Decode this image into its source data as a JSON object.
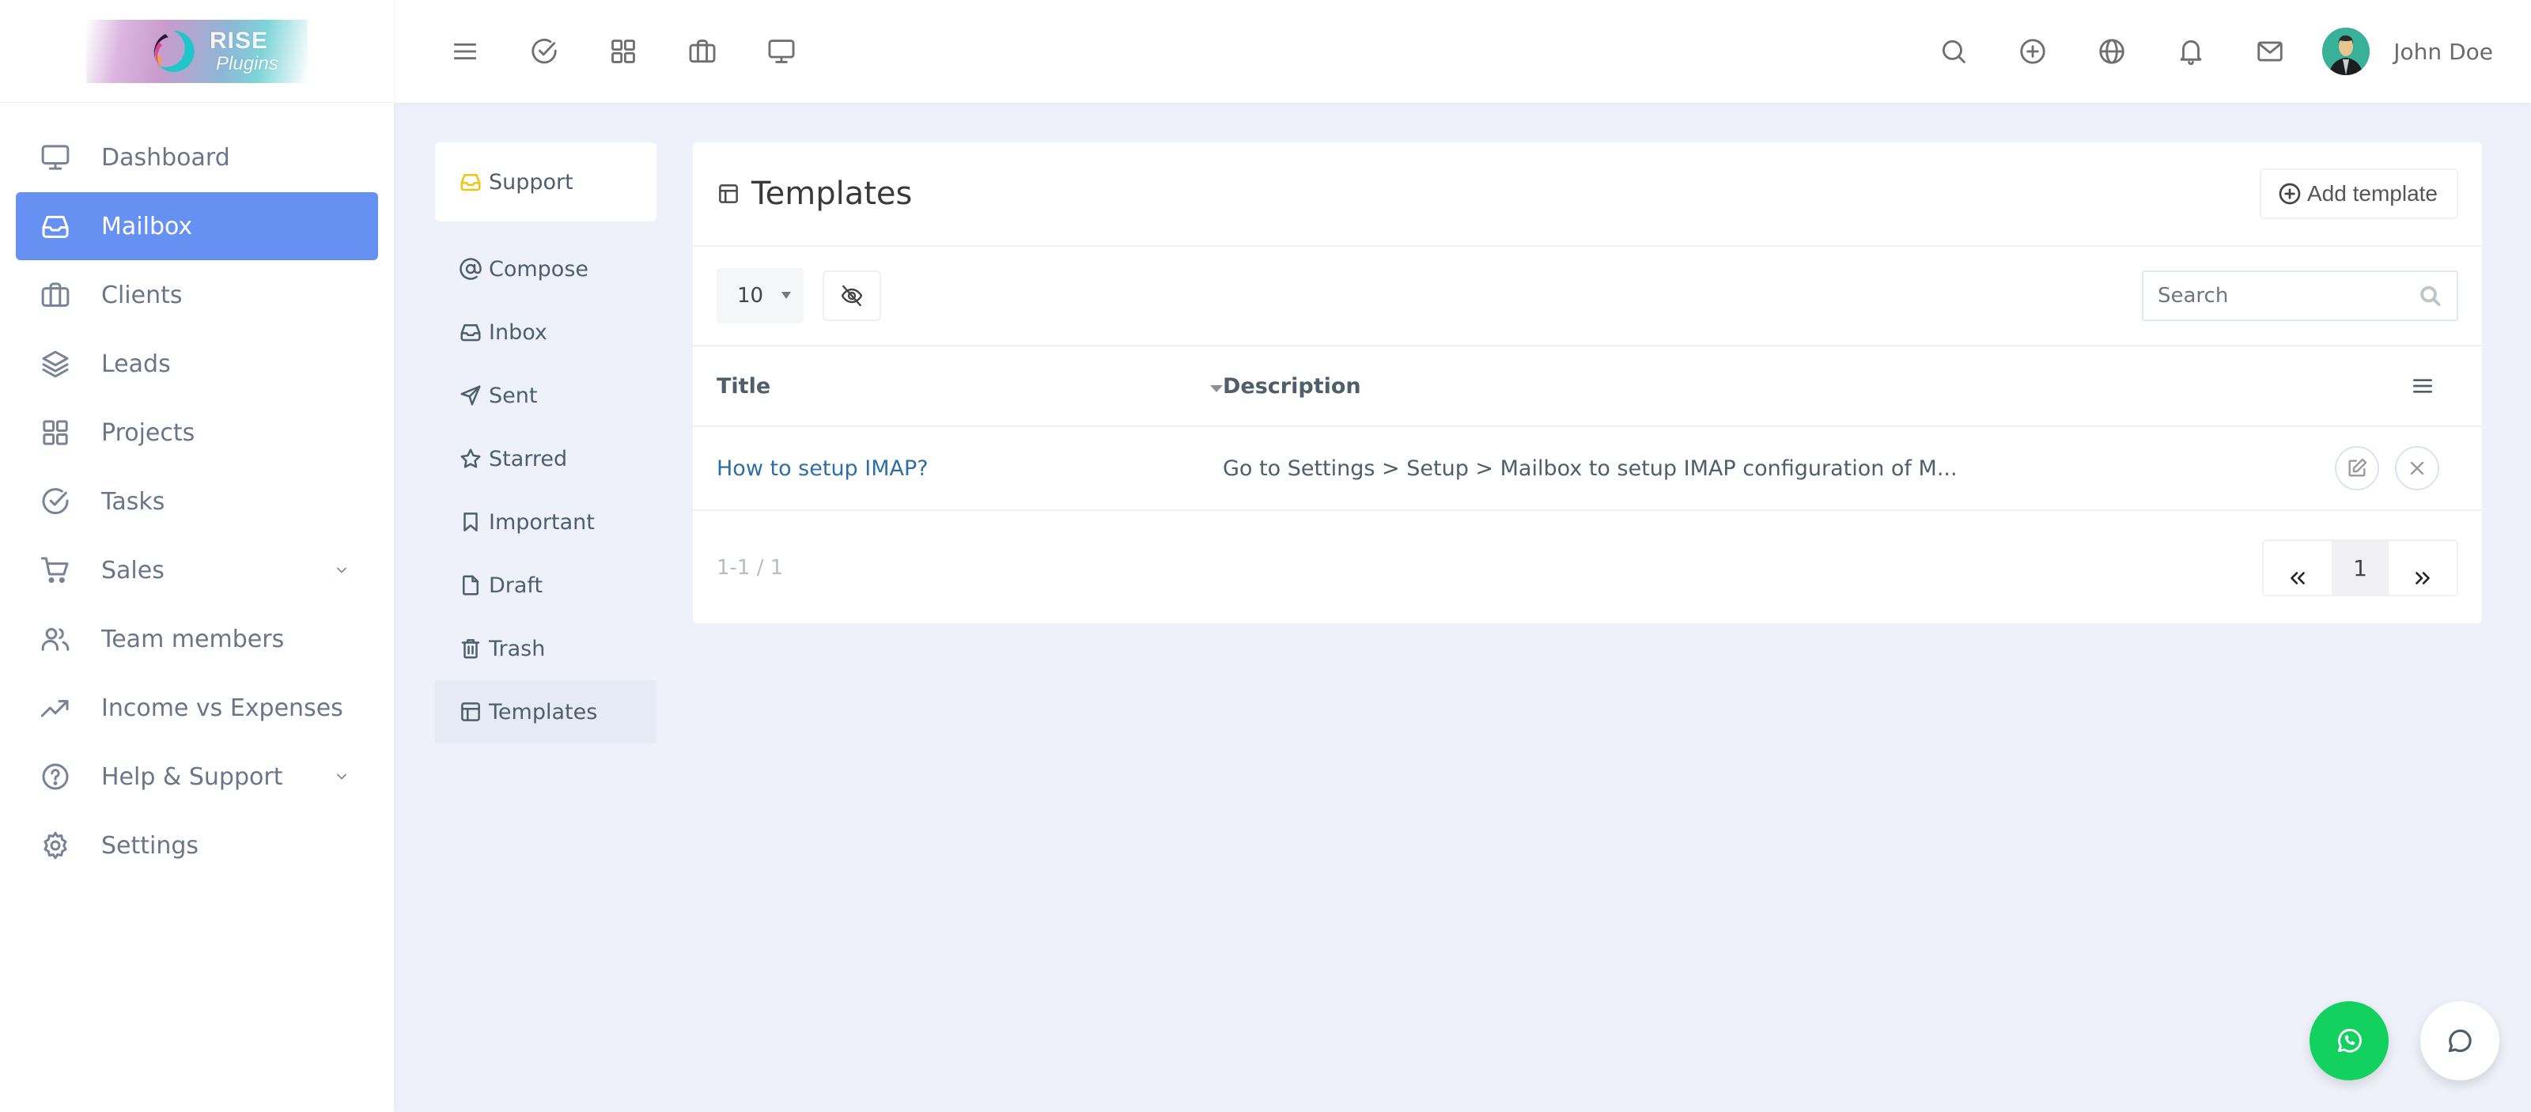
{
  "brand": {
    "line1": "RISE",
    "line2": "Plugins"
  },
  "topbar": {
    "left_icons": [
      "menu-icon",
      "check-circle-icon",
      "grid-icon",
      "briefcase-icon",
      "monitor-icon"
    ],
    "right_icons": [
      "search-icon",
      "plus-circle-icon",
      "globe-icon",
      "bell-icon",
      "mail-icon"
    ],
    "user_name": "John Doe"
  },
  "sidebar": {
    "items": [
      {
        "label": "Dashboard",
        "icon": "monitor-icon",
        "active": false,
        "has_submenu": false
      },
      {
        "label": "Mailbox",
        "icon": "inbox-icon",
        "active": true,
        "has_submenu": false
      },
      {
        "label": "Clients",
        "icon": "briefcase-icon",
        "active": false,
        "has_submenu": false
      },
      {
        "label": "Leads",
        "icon": "layers-icon",
        "active": false,
        "has_submenu": false
      },
      {
        "label": "Projects",
        "icon": "grid-icon",
        "active": false,
        "has_submenu": false
      },
      {
        "label": "Tasks",
        "icon": "check-circle-icon",
        "active": false,
        "has_submenu": false
      },
      {
        "label": "Sales",
        "icon": "cart-icon",
        "active": false,
        "has_submenu": true
      },
      {
        "label": "Team members",
        "icon": "users-icon",
        "active": false,
        "has_submenu": false
      },
      {
        "label": "Income vs Expenses",
        "icon": "trending-up-icon",
        "active": false,
        "has_submenu": false
      },
      {
        "label": "Help & Support",
        "icon": "help-circle-icon",
        "active": false,
        "has_submenu": true
      },
      {
        "label": "Settings",
        "icon": "gear-icon",
        "active": false,
        "has_submenu": false
      }
    ]
  },
  "mailbox_nav": {
    "account": {
      "label": "Support",
      "icon": "inbox-icon",
      "icon_color": "#f1c40f"
    },
    "items": [
      {
        "label": "Compose",
        "icon": "at-icon",
        "active": false
      },
      {
        "label": "Inbox",
        "icon": "inbox-icon",
        "active": false
      },
      {
        "label": "Sent",
        "icon": "send-icon",
        "active": false
      },
      {
        "label": "Starred",
        "icon": "star-icon",
        "active": false
      },
      {
        "label": "Important",
        "icon": "bookmark-icon",
        "active": false
      },
      {
        "label": "Draft",
        "icon": "file-icon",
        "active": false
      },
      {
        "label": "Trash",
        "icon": "trash-icon",
        "active": false
      },
      {
        "label": "Templates",
        "icon": "layout-icon",
        "active": true
      }
    ]
  },
  "templates": {
    "title": "Templates",
    "add_button": "Add template",
    "page_size": "10",
    "search_placeholder": "Search",
    "search_value": "",
    "columns": [
      "Title",
      "Description"
    ],
    "rows": [
      {
        "title": "How to setup IMAP?",
        "description": "Go to Settings > Setup > Mailbox to setup IMAP configuration of M..."
      }
    ],
    "summary": "1-1 / 1",
    "pagination": {
      "prev": "«",
      "current": "1",
      "next": "»"
    }
  },
  "colors": {
    "accent": "#6690f2",
    "link": "#2f6ea5",
    "whatsapp": "#12d15f",
    "background": "#eef1f9"
  }
}
